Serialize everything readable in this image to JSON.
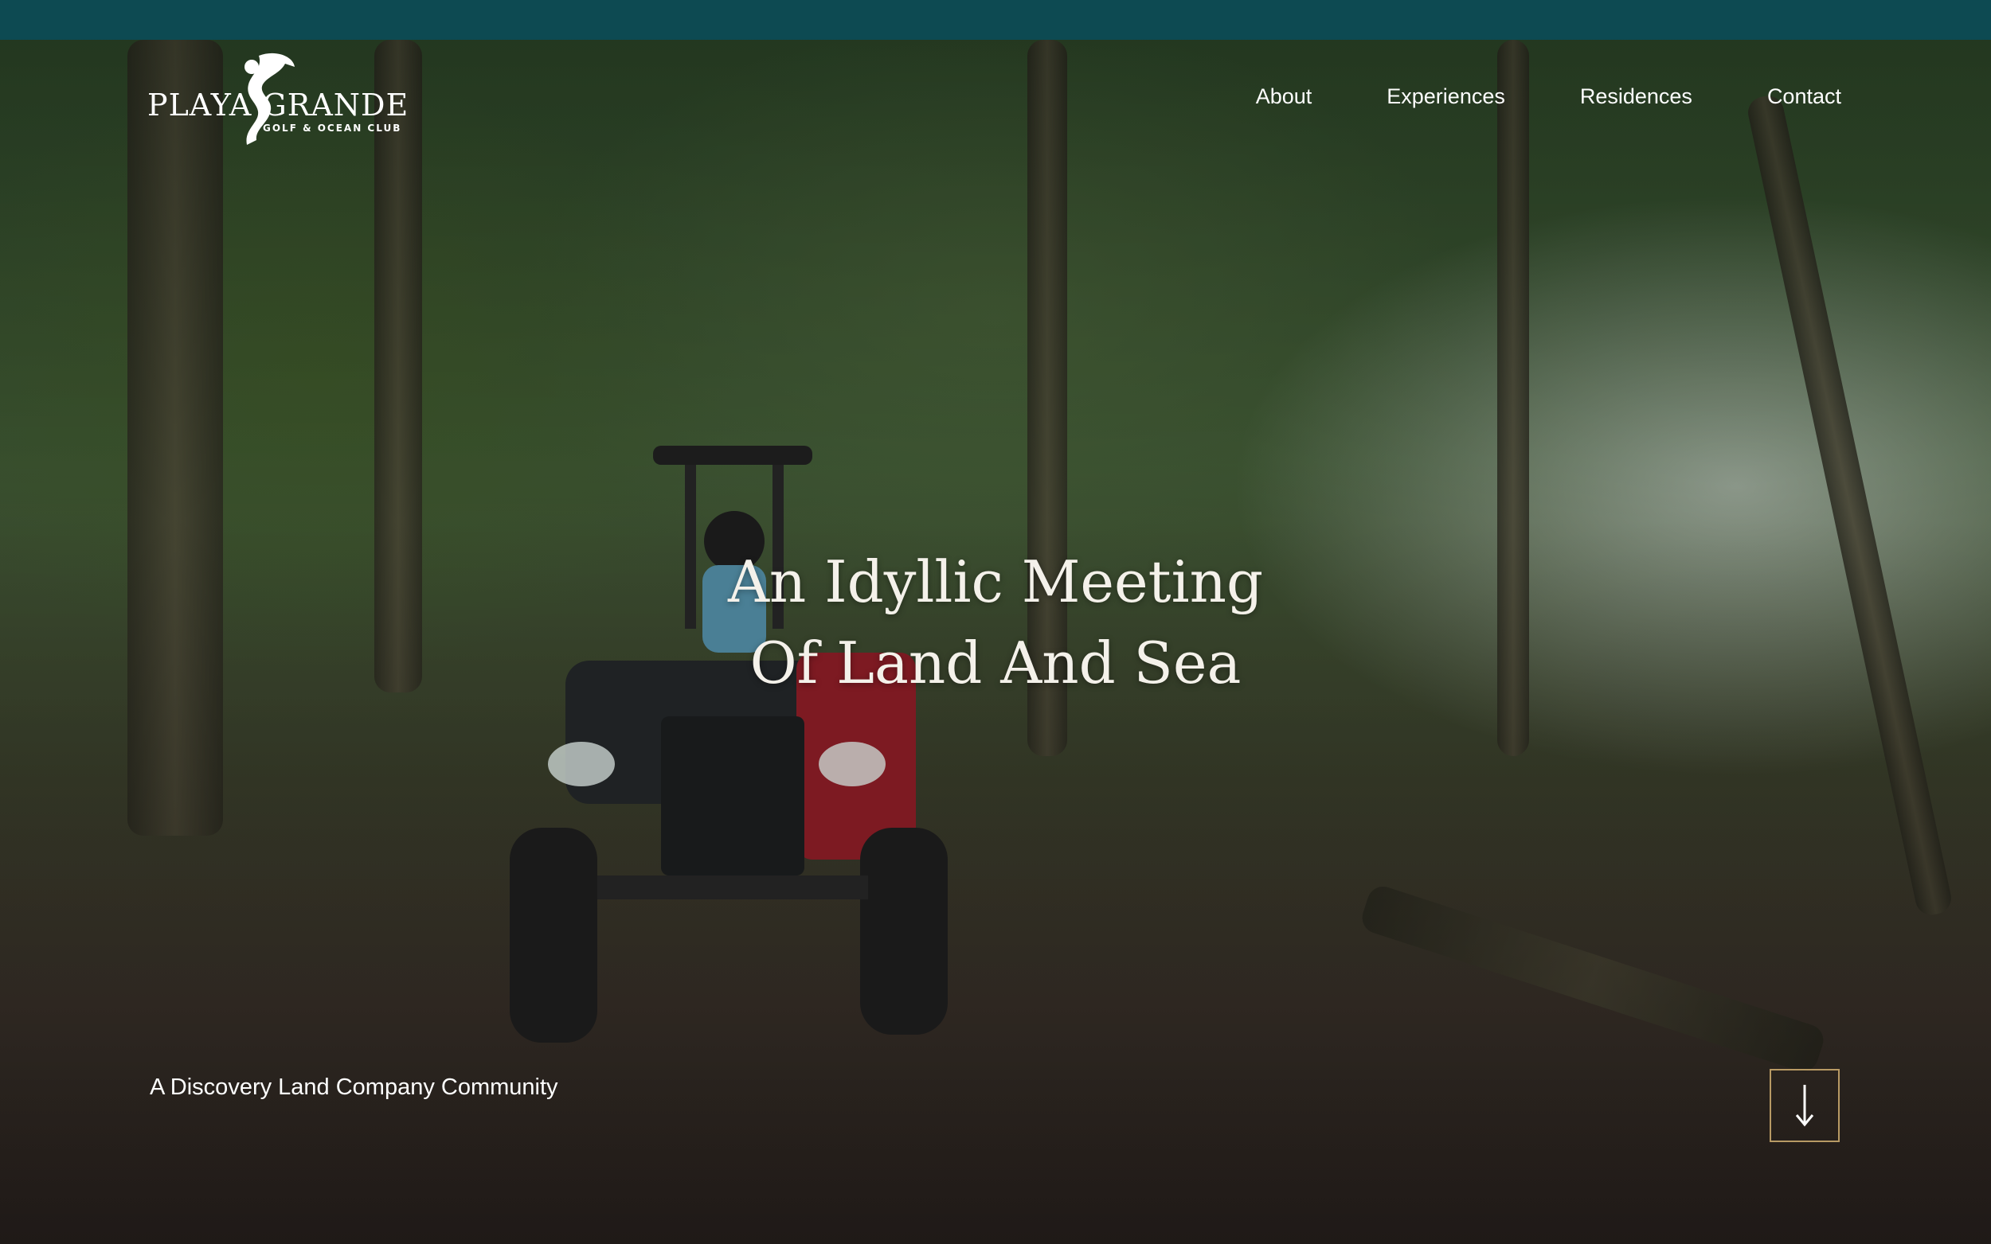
{
  "brand": {
    "name": "PLAYA GRANDE",
    "subtitle": "GOLF & OCEAN CLUB"
  },
  "nav": {
    "items": [
      "About",
      "Experiences",
      "Residences",
      "Contact"
    ]
  },
  "hero": {
    "headline_line1": "An Idyllic Meeting",
    "headline_line2": "Of Land And Sea",
    "tagline": "A Discovery Land Company Community"
  },
  "scroll": {
    "icon": "arrow-down-icon"
  },
  "colors": {
    "topbar": "#0d4a52",
    "button_border": "#b89a64"
  }
}
